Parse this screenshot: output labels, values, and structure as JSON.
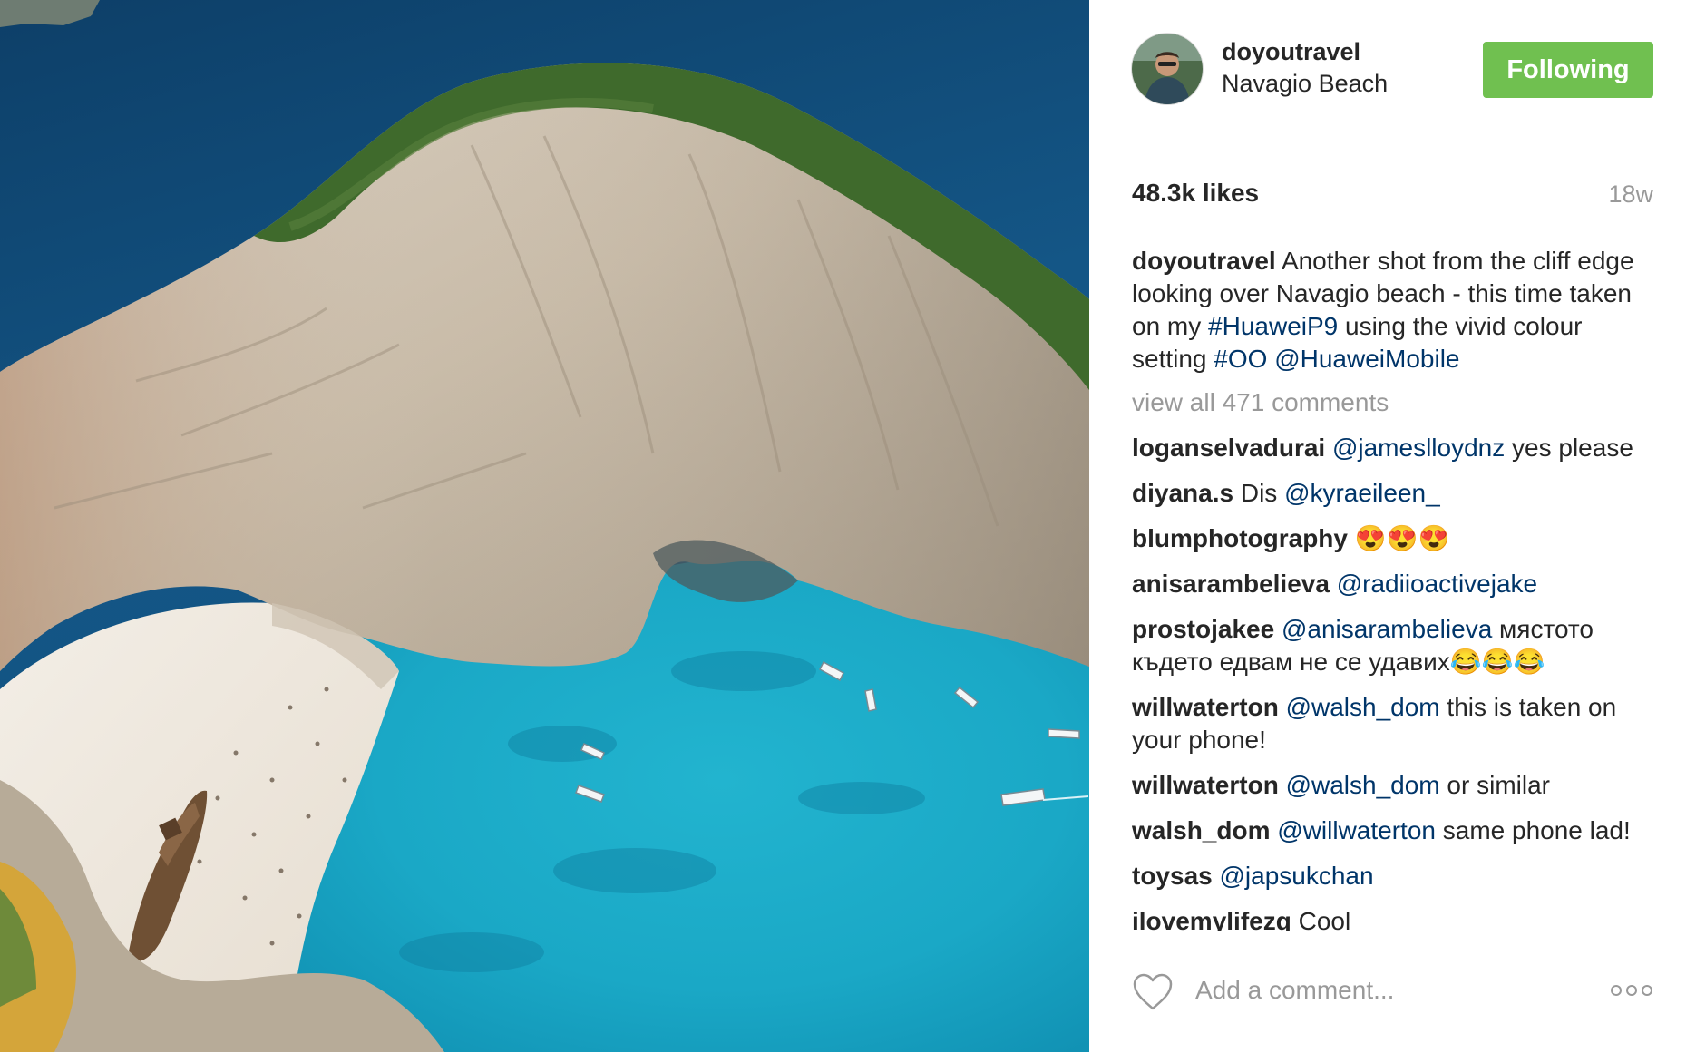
{
  "post": {
    "username": "doyoutravel",
    "location": "Navagio Beach",
    "follow_label": "Following",
    "likes": "48.3k likes",
    "time": "18w",
    "caption": [
      {
        "t": "doyoutravel",
        "k": "uname"
      },
      {
        "t": " Another shot from the cliff edge looking over Navagio beach - this time taken on my ",
        "k": "text"
      },
      {
        "t": "#HuaweiP9",
        "k": "hashtag"
      },
      {
        "t": " using the vivid colour setting ",
        "k": "text"
      },
      {
        "t": "#OO",
        "k": "hashtag"
      },
      {
        "t": " ",
        "k": "text"
      },
      {
        "t": "@HuaweiMobile",
        "k": "mention"
      }
    ],
    "view_all": "view all 471 comments"
  },
  "comments": [
    {
      "user": "loganselvadurai",
      "parts": [
        {
          "t": " ",
          "k": "text"
        },
        {
          "t": "@jameslloydnz",
          "k": "mention"
        },
        {
          "t": " yes please",
          "k": "text"
        }
      ]
    },
    {
      "user": "diyana.s",
      "parts": [
        {
          "t": " Dis ",
          "k": "text"
        },
        {
          "t": "@kyraeileen_",
          "k": "mention"
        }
      ]
    },
    {
      "user": "blumphotography",
      "parts": [
        {
          "t": " 😍😍😍",
          "k": "text"
        }
      ]
    },
    {
      "user": "anisarambelieva",
      "parts": [
        {
          "t": " ",
          "k": "text"
        },
        {
          "t": "@radiioactivejake",
          "k": "mention"
        }
      ]
    },
    {
      "user": "prostojakee",
      "parts": [
        {
          "t": " ",
          "k": "text"
        },
        {
          "t": "@anisarambelieva",
          "k": "mention"
        },
        {
          "t": " мястото където едвам не се удавих😂😂😂",
          "k": "text"
        }
      ]
    },
    {
      "user": "willwaterton",
      "parts": [
        {
          "t": " ",
          "k": "text"
        },
        {
          "t": "@walsh_dom",
          "k": "mention"
        },
        {
          "t": " this is taken on your phone!",
          "k": "text"
        }
      ]
    },
    {
      "user": "willwaterton",
      "parts": [
        {
          "t": " ",
          "k": "text"
        },
        {
          "t": "@walsh_dom",
          "k": "mention"
        },
        {
          "t": " or similar",
          "k": "text"
        }
      ]
    },
    {
      "user": "walsh_dom",
      "parts": [
        {
          "t": " ",
          "k": "text"
        },
        {
          "t": "@willwaterton",
          "k": "mention"
        },
        {
          "t": " same phone lad!",
          "k": "text"
        }
      ]
    },
    {
      "user": "toysas",
      "parts": [
        {
          "t": " ",
          "k": "text"
        },
        {
          "t": "@japsukchan",
          "k": "mention"
        }
      ]
    },
    {
      "user": "ilovemylifezq",
      "parts": [
        {
          "t": " Cool",
          "k": "text"
        }
      ]
    }
  ],
  "footer": {
    "placeholder": "Add a comment...",
    "heart_icon": "heart-outline-icon",
    "more_icon": "more-options-icon"
  },
  "colors": {
    "follow_button": "#70c050",
    "link": "#003569",
    "muted": "#999999"
  }
}
